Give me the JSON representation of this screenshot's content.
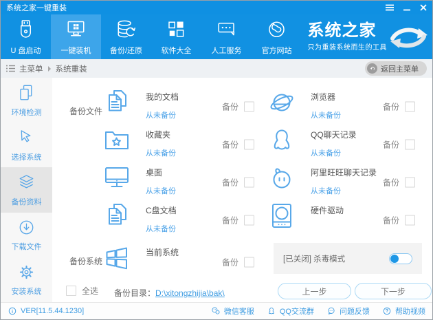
{
  "window": {
    "title": "系统之家一键重装"
  },
  "nav": {
    "items": [
      {
        "label": "U 盘启动",
        "icon": "usb-icon",
        "active": false
      },
      {
        "label": "一键装机",
        "icon": "monitor-windows-icon",
        "active": true
      },
      {
        "label": "备份/还原",
        "icon": "backup-restore-icon",
        "active": false
      },
      {
        "label": "软件大全",
        "icon": "software-grid-icon",
        "active": false
      },
      {
        "label": "人工服务",
        "icon": "chat-service-icon",
        "active": false
      },
      {
        "label": "官方网站",
        "icon": "globe-icon",
        "active": false
      }
    ],
    "brand": {
      "name": "系统之家",
      "tagline": "只为重装系统而生的工具"
    }
  },
  "breadcrumb": {
    "root": "主菜单",
    "current": "系统重装",
    "back_button": "返回主菜单"
  },
  "sidebar": {
    "items": [
      {
        "label": "环境检测",
        "icon": "env-check-icon",
        "active": false
      },
      {
        "label": "选择系统",
        "icon": "cursor-icon",
        "active": false
      },
      {
        "label": "备份资料",
        "icon": "layers-icon",
        "active": true
      },
      {
        "label": "下载文件",
        "icon": "download-icon",
        "active": false
      },
      {
        "label": "安装系统",
        "icon": "gear-icon",
        "active": false
      }
    ]
  },
  "backup": {
    "files_label": "备份文件",
    "system_label": "备份系统",
    "backup_label": "备份",
    "items": [
      {
        "title": "我的文档",
        "status": "从未备份",
        "icon": "documents-icon"
      },
      {
        "title": "浏览器",
        "status": "从未备份",
        "icon": "browser-icon"
      },
      {
        "title": "收藏夹",
        "status": "从未备份",
        "icon": "folder-star-icon"
      },
      {
        "title": "QQ聊天记录",
        "status": "从未备份",
        "icon": "qq-penguin-icon"
      },
      {
        "title": "桌面",
        "status": "从未备份",
        "icon": "desktop-icon"
      },
      {
        "title": "阿里旺旺聊天记录",
        "status": "从未备份",
        "icon": "aliwangwang-icon"
      },
      {
        "title": "C盘文档",
        "status": "从未备份",
        "icon": "documents-icon"
      },
      {
        "title": "硬件驱动",
        "icon": "hardware-driver-icon"
      }
    ],
    "system_item": {
      "title": "当前系统",
      "icon": "windows-flag-icon"
    },
    "antivirus": {
      "label": "[已关闭] 杀毒模式",
      "enabled": false
    }
  },
  "footer_controls": {
    "select_all": "全选",
    "backup_dir_label": "备份目录：",
    "backup_dir_path": "D:\\xitongzhijia\\bak\\",
    "prev_button": "上一步",
    "next_button": "下一步"
  },
  "statusbar": {
    "version": "VER[11.5.44.1230]",
    "links": [
      {
        "label": "微信客服",
        "icon": "wechat-icon"
      },
      {
        "label": "QQ交流群",
        "icon": "qq-group-icon"
      },
      {
        "label": "问题反馈",
        "icon": "feedback-icon"
      },
      {
        "label": "帮助视频",
        "icon": "help-video-icon"
      }
    ]
  },
  "colors": {
    "accent_blue": "#1191e2",
    "nav_active": "#3da5ea",
    "icon_blue": "#58a8e9",
    "link_blue": "#3e9ce2"
  }
}
